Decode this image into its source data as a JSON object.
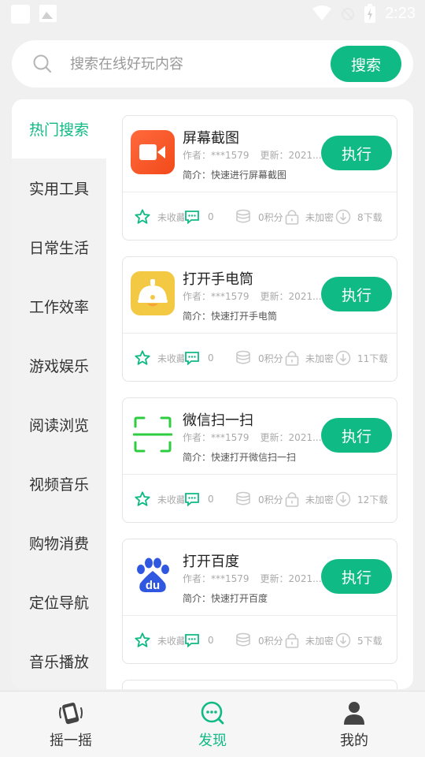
{
  "status_bar": {
    "time": "2:23"
  },
  "search": {
    "placeholder": "搜索在线好玩内容",
    "button": "搜索"
  },
  "categories": [
    {
      "label": "热门搜索",
      "active": true
    },
    {
      "label": "实用工具"
    },
    {
      "label": "日常生活"
    },
    {
      "label": "工作效率"
    },
    {
      "label": "游戏娱乐"
    },
    {
      "label": "阅读浏览"
    },
    {
      "label": "视频音乐"
    },
    {
      "label": "购物消费"
    },
    {
      "label": "定位导航"
    },
    {
      "label": "音乐播放"
    }
  ],
  "cards": [
    {
      "title": "屏幕截图",
      "author": "作者：***1579",
      "updated": "更新：2021...",
      "desc": "简介：快速进行屏幕截图",
      "action": "执行",
      "icon": "screen-record-icon",
      "fav": "未收藏",
      "comments": "0",
      "points": "0积分",
      "lock": "未加密",
      "downloads": "8下载"
    },
    {
      "title": "打开手电筒",
      "author": "作者：***1579",
      "updated": "更新：2021...",
      "desc": "简介：快速打开手电筒",
      "action": "执行",
      "icon": "lamp-icon",
      "fav": "未收藏",
      "comments": "0",
      "points": "0积分",
      "lock": "未加密",
      "downloads": "11下载"
    },
    {
      "title": "微信扫一扫",
      "author": "作者：***1579",
      "updated": "更新：2021...",
      "desc": "简介：快速打开微信扫一扫",
      "action": "执行",
      "icon": "scan-icon",
      "fav": "未收藏",
      "comments": "0",
      "points": "0积分",
      "lock": "未加密",
      "downloads": "12下载"
    },
    {
      "title": "打开百度",
      "author": "作者：***1579",
      "updated": "更新：2021...",
      "desc": "简介：快速打开百度",
      "action": "执行",
      "icon": "baidu-icon",
      "fav": "未收藏",
      "comments": "0",
      "points": "0积分",
      "lock": "未加密",
      "downloads": "5下载"
    }
  ],
  "bottom_nav": [
    {
      "label": "摇一摇",
      "icon": "shake-phone-icon"
    },
    {
      "label": "发现",
      "icon": "discover-icon",
      "active": true
    },
    {
      "label": "我的",
      "icon": "profile-icon"
    }
  ],
  "colors": {
    "accent": "#0fba84",
    "background": "#f0f0f0"
  }
}
